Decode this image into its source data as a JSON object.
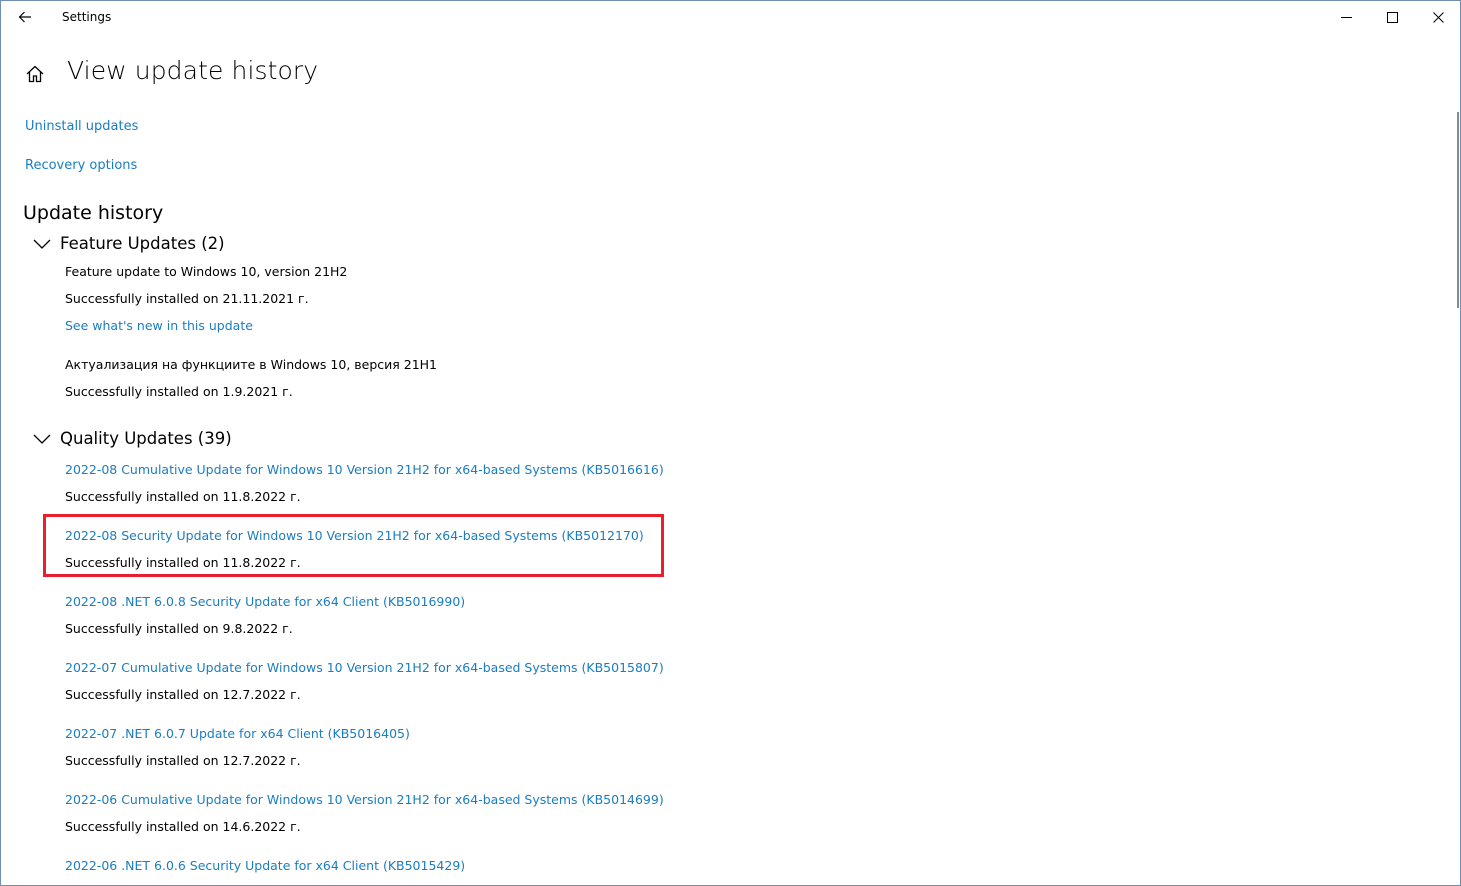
{
  "window": {
    "app_title": "Settings"
  },
  "page": {
    "title": "View update history",
    "links": {
      "uninstall": "Uninstall updates",
      "recovery": "Recovery options"
    },
    "section_title": "Update history"
  },
  "feature_updates": {
    "label": "Feature Updates (2)",
    "items": [
      {
        "name": "Feature update to Windows 10, version 21H2",
        "status": "Successfully installed on 21.11.2021 г.",
        "link": "See what's new in this update"
      },
      {
        "name": "Актуализация на функциите в Windows 10, версия 21H1",
        "status": "Successfully installed on 1.9.2021 г."
      }
    ]
  },
  "quality_updates": {
    "label": "Quality Updates (39)",
    "items": [
      {
        "name": "2022-08 Cumulative Update for Windows 10 Version 21H2 for x64-based Systems (KB5016616)",
        "status": "Successfully installed on 11.8.2022 г."
      },
      {
        "name": "2022-08 Security Update for Windows 10 Version 21H2 for x64-based Systems (KB5012170)",
        "status": "Successfully installed on 11.8.2022 г."
      },
      {
        "name": "2022-08 .NET 6.0.8 Security Update for x64 Client (KB5016990)",
        "status": "Successfully installed on 9.8.2022 г."
      },
      {
        "name": "2022-07 Cumulative Update for Windows 10 Version 21H2 for x64-based Systems (KB5015807)",
        "status": "Successfully installed on 12.7.2022 г."
      },
      {
        "name": "2022-07 .NET 6.0.7 Update for x64 Client (KB5016405)",
        "status": "Successfully installed on 12.7.2022 г."
      },
      {
        "name": "2022-06 Cumulative Update for Windows 10 Version 21H2 for x64-based Systems (KB5014699)",
        "status": "Successfully installed on 14.6.2022 г."
      },
      {
        "name": "2022-06 .NET 6.0.6 Security Update for x64 Client (KB5015429)"
      }
    ]
  },
  "icons": {
    "back": "back-arrow-icon",
    "home": "home-icon",
    "minimize": "minimize-icon",
    "maximize": "maximize-icon",
    "close": "close-icon",
    "chevron": "chevron-down-icon"
  },
  "colors": {
    "link": "#1a7dc0",
    "highlight": "#e8202e",
    "frame": "#6f8fb0"
  }
}
